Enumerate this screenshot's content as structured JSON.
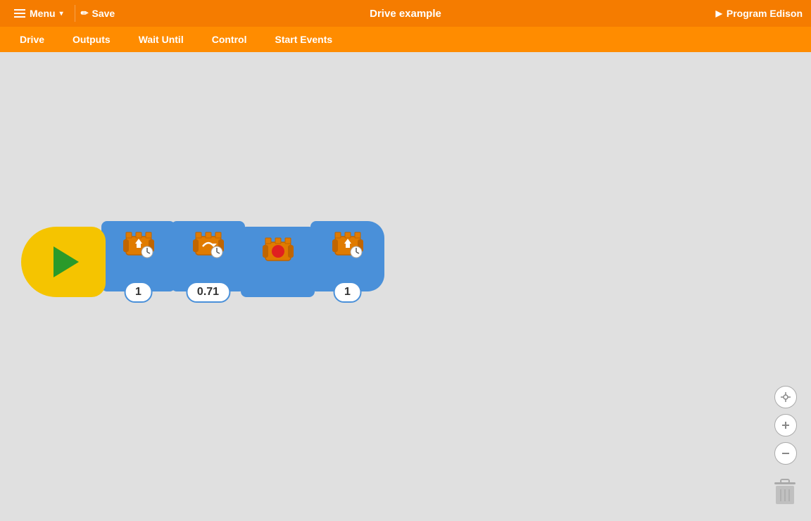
{
  "topbar": {
    "menu_label": "Menu",
    "save_label": "Save",
    "title": "Drive example",
    "program_label": "Program Edison"
  },
  "navbar": {
    "items": [
      {
        "id": "drive",
        "label": "Drive"
      },
      {
        "id": "outputs",
        "label": "Outputs"
      },
      {
        "id": "wait-until",
        "label": "Wait Until"
      },
      {
        "id": "control",
        "label": "Control"
      },
      {
        "id": "start-events",
        "label": "Start Events"
      }
    ]
  },
  "blocks": [
    {
      "id": "start",
      "type": "start"
    },
    {
      "id": "block1",
      "type": "drive-forward",
      "value": "1"
    },
    {
      "id": "block2",
      "type": "drive-turn",
      "value": "0.71"
    },
    {
      "id": "block3",
      "type": "drive-stop",
      "value": null
    },
    {
      "id": "block4",
      "type": "drive-forward",
      "value": "1"
    }
  ],
  "controls": {
    "recenter_title": "Re-center",
    "zoom_in_title": "Zoom in",
    "zoom_out_title": "Zoom out",
    "trash_title": "Delete"
  }
}
